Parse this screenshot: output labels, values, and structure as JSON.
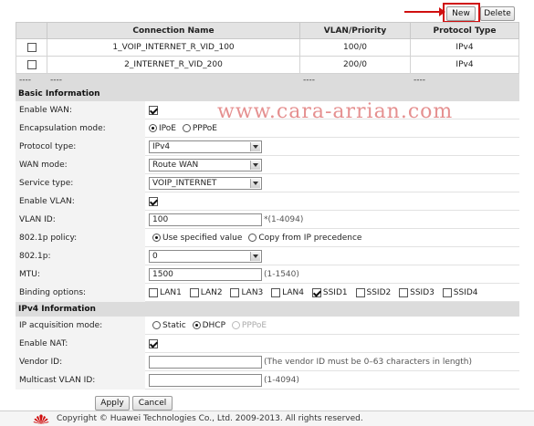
{
  "toolbar": {
    "new_label": "New",
    "delete_label": "Delete"
  },
  "connections": {
    "headers": [
      "Connection Name",
      "VLAN/Priority",
      "Protocol Type"
    ],
    "rows": [
      {
        "name": "1_VOIP_INTERNET_R_VID_100",
        "vlan": "100/0",
        "protocol": "IPv4"
      },
      {
        "name": "2_INTERNET_R_VID_200",
        "vlan": "200/0",
        "protocol": "IPv4"
      }
    ],
    "placeholder": [
      "----",
      "----",
      "----",
      "----"
    ]
  },
  "watermark": "www.cara-arrian.com",
  "basic": {
    "section_title": "Basic Information",
    "enable_wan": {
      "label": "Enable WAN:",
      "checked": true
    },
    "encapsulation": {
      "label": "Encapsulation mode:",
      "options": [
        "IPoE",
        "PPPoE"
      ],
      "selected": "IPoE"
    },
    "protocol_type": {
      "label": "Protocol type:",
      "value": "IPv4"
    },
    "wan_mode": {
      "label": "WAN mode:",
      "value": "Route WAN"
    },
    "service_type": {
      "label": "Service type:",
      "value": "VOIP_INTERNET"
    },
    "enable_vlan": {
      "label": "Enable VLAN:",
      "checked": true
    },
    "vlan_id": {
      "label": "VLAN ID:",
      "value": "100",
      "hint": "*(1-4094)"
    },
    "policy_8021p": {
      "label": "802.1p policy:",
      "options": [
        "Use specified value",
        "Copy from IP precedence"
      ],
      "selected": "Use specified value"
    },
    "p8021": {
      "label": "802.1p:",
      "value": "0"
    },
    "mtu": {
      "label": "MTU:",
      "value": "1500",
      "hint": "(1-1540)"
    },
    "binding": {
      "label": "Binding options:",
      "options": [
        "LAN1",
        "LAN2",
        "LAN3",
        "LAN4",
        "SSID1",
        "SSID2",
        "SSID3",
        "SSID4"
      ],
      "checked": [
        "SSID1"
      ]
    }
  },
  "ipv4": {
    "section_title": "IPv4 Information",
    "acquisition": {
      "label": "IP acquisition mode:",
      "options": [
        "Static",
        "DHCP",
        "PPPoE"
      ],
      "selected": "DHCP"
    },
    "enable_nat": {
      "label": "Enable NAT:",
      "checked": true
    },
    "vendor_id": {
      "label": "Vendor ID:",
      "value": "",
      "hint": "(The vendor ID must be 0–63 characters in length)"
    },
    "multicast_vlan": {
      "label": "Multicast VLAN ID:",
      "value": "",
      "hint": "(1-4094)"
    }
  },
  "actions": {
    "apply_label": "Apply",
    "cancel_label": "Cancel"
  },
  "footer": {
    "copyright": "Copyright © Huawei Technologies Co., Ltd. 2009-2013. All rights reserved."
  },
  "colors": {
    "highlight": "#d01010",
    "watermark": "#e59090",
    "section_bg": "#dcdcdc",
    "label_bg": "#f3f3f3"
  }
}
